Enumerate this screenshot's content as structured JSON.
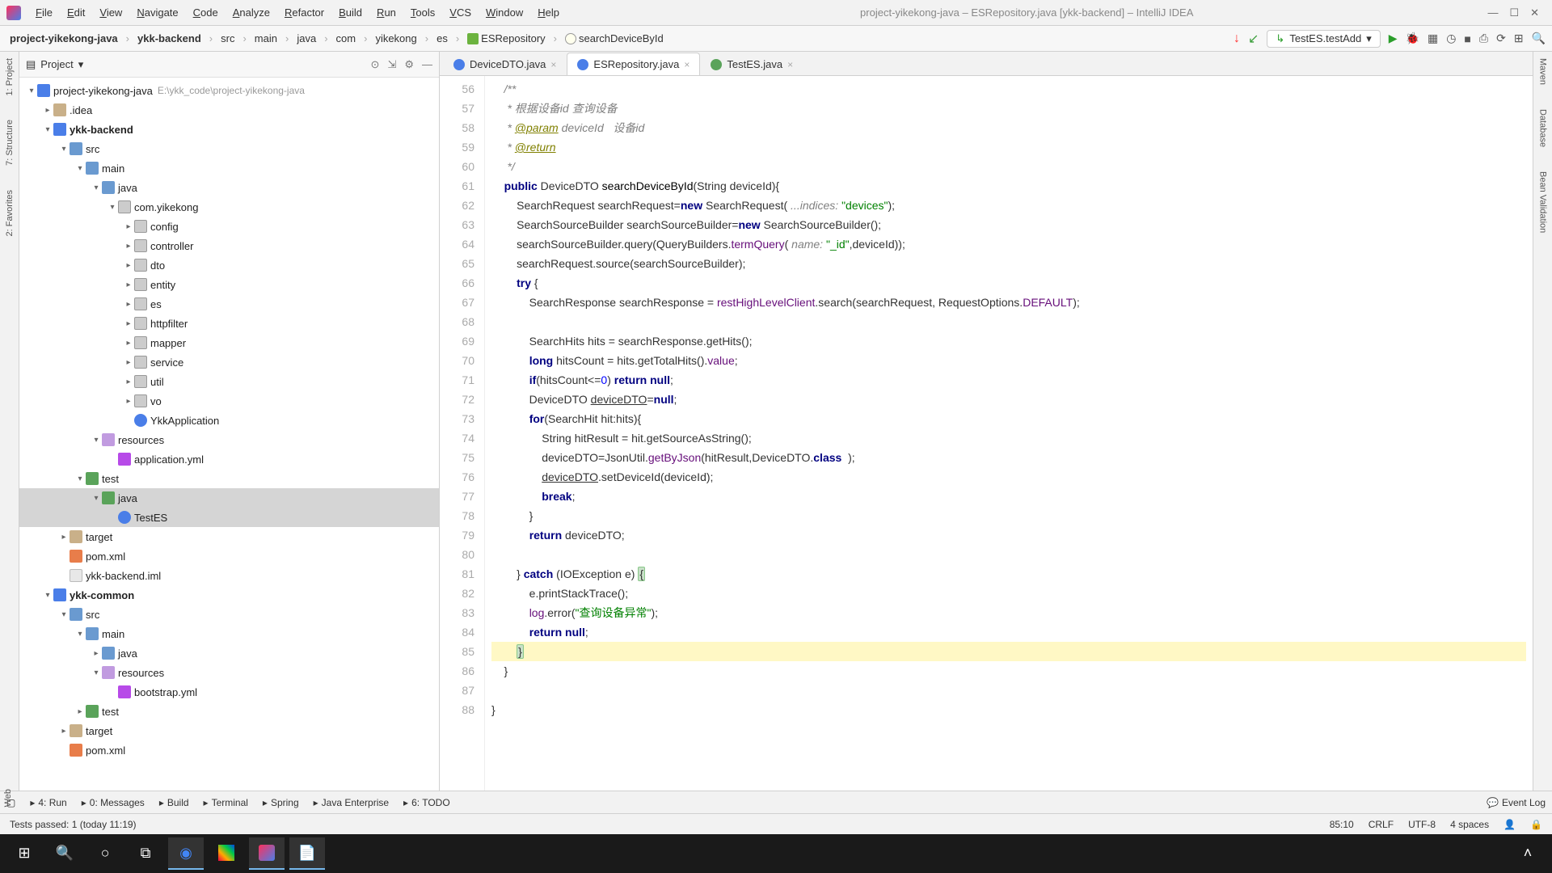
{
  "title": "project-yikekong-java – ESRepository.java [ykk-backend] – IntelliJ IDEA",
  "menus": [
    "File",
    "Edit",
    "View",
    "Navigate",
    "Code",
    "Analyze",
    "Refactor",
    "Build",
    "Run",
    "Tools",
    "VCS",
    "Window",
    "Help"
  ],
  "breadcrumbs": {
    "items": [
      "project-yikekong-java",
      "ykk-backend",
      "src",
      "main",
      "java",
      "com",
      "yikekong",
      "es"
    ],
    "file": "ESRepository",
    "method": "searchDeviceById"
  },
  "run_config": "TestES.testAdd",
  "project_label": "Project",
  "tree": [
    {
      "d": 0,
      "a": "▾",
      "i": "mod",
      "l": "project-yikekong-java",
      "extra": "E:\\ykk_code\\project-yikekong-java"
    },
    {
      "d": 1,
      "a": "▸",
      "i": "dir",
      "l": ".idea"
    },
    {
      "d": 1,
      "a": "▾",
      "i": "mod",
      "l": "ykk-backend",
      "bold": true
    },
    {
      "d": 2,
      "a": "▾",
      "i": "srcdir",
      "l": "src"
    },
    {
      "d": 3,
      "a": "▾",
      "i": "srcdir",
      "l": "main"
    },
    {
      "d": 4,
      "a": "▾",
      "i": "srcdir",
      "l": "java"
    },
    {
      "d": 5,
      "a": "▾",
      "i": "pkg",
      "l": "com.yikekong"
    },
    {
      "d": 6,
      "a": "▸",
      "i": "pkg",
      "l": "config"
    },
    {
      "d": 6,
      "a": "▸",
      "i": "pkg",
      "l": "controller"
    },
    {
      "d": 6,
      "a": "▸",
      "i": "pkg",
      "l": "dto"
    },
    {
      "d": 6,
      "a": "▸",
      "i": "pkg",
      "l": "entity"
    },
    {
      "d": 6,
      "a": "▸",
      "i": "pkg",
      "l": "es"
    },
    {
      "d": 6,
      "a": "▸",
      "i": "pkg",
      "l": "httpfilter"
    },
    {
      "d": 6,
      "a": "▸",
      "i": "pkg",
      "l": "mapper"
    },
    {
      "d": 6,
      "a": "▸",
      "i": "pkg",
      "l": "service"
    },
    {
      "d": 6,
      "a": "▸",
      "i": "pkg",
      "l": "util"
    },
    {
      "d": 6,
      "a": "▸",
      "i": "pkg",
      "l": "vo"
    },
    {
      "d": 6,
      "a": "",
      "i": "java",
      "l": "YkkApplication"
    },
    {
      "d": 4,
      "a": "▾",
      "i": "resdir",
      "l": "resources"
    },
    {
      "d": 5,
      "a": "",
      "i": "yml",
      "l": "application.yml"
    },
    {
      "d": 3,
      "a": "▾",
      "i": "testdir",
      "l": "test"
    },
    {
      "d": 4,
      "a": "▾",
      "i": "testdir",
      "l": "java",
      "sel": true
    },
    {
      "d": 5,
      "a": "",
      "i": "java",
      "l": "TestES",
      "sel": true
    },
    {
      "d": 2,
      "a": "▸",
      "i": "dir",
      "l": "target"
    },
    {
      "d": 2,
      "a": "",
      "i": "xml",
      "l": "pom.xml"
    },
    {
      "d": 2,
      "a": "",
      "i": "file",
      "l": "ykk-backend.iml"
    },
    {
      "d": 1,
      "a": "▾",
      "i": "mod",
      "l": "ykk-common",
      "bold": true
    },
    {
      "d": 2,
      "a": "▾",
      "i": "srcdir",
      "l": "src"
    },
    {
      "d": 3,
      "a": "▾",
      "i": "srcdir",
      "l": "main"
    },
    {
      "d": 4,
      "a": "▸",
      "i": "srcdir",
      "l": "java"
    },
    {
      "d": 4,
      "a": "▾",
      "i": "resdir",
      "l": "resources"
    },
    {
      "d": 5,
      "a": "",
      "i": "yml",
      "l": "bootstrap.yml"
    },
    {
      "d": 3,
      "a": "▸",
      "i": "testdir",
      "l": "test"
    },
    {
      "d": 2,
      "a": "▸",
      "i": "dir",
      "l": "target"
    },
    {
      "d": 2,
      "a": "",
      "i": "xml",
      "l": "pom.xml"
    }
  ],
  "tabs": [
    {
      "label": "DeviceDTO.java",
      "active": false,
      "ic": "blue"
    },
    {
      "label": "ESRepository.java",
      "active": true,
      "ic": "blue"
    },
    {
      "label": "TestES.java",
      "active": false,
      "ic": "green"
    }
  ],
  "code": {
    "start": 56,
    "lines": [
      {
        "t": "doc",
        "txt": "    /**"
      },
      {
        "t": "doc",
        "txt": "     * 根据设备id 查询设备"
      },
      {
        "t": "doc",
        "txt": "     * <tag>@param</tag> deviceId   设备id"
      },
      {
        "t": "doc",
        "txt": "     * <tag>@return</tag>"
      },
      {
        "t": "doc",
        "txt": "     */"
      },
      {
        "t": "code",
        "txt": "    <kw>public</kw> DeviceDTO <call>searchDeviceById</call>(String deviceId){"
      },
      {
        "t": "code",
        "txt": "        SearchRequest searchRequest=<kw>new</kw> SearchRequest( <param>...indices:</param> <str>\"devices\"</str>);"
      },
      {
        "t": "code",
        "txt": "        SearchSourceBuilder searchSourceBuilder=<kw>new</kw> SearchSourceBuilder();"
      },
      {
        "t": "code",
        "txt": "        searchSourceBuilder.query(QueryBuilders.<fld>termQuery</fld>( <param>name:</param> <str>\"_id\"</str>,deviceId));"
      },
      {
        "t": "code",
        "txt": "        searchRequest.source(searchSourceBuilder);"
      },
      {
        "t": "code",
        "txt": "        <kw>try</kw> {"
      },
      {
        "t": "code",
        "txt": "            SearchResponse searchResponse = <fld>restHighLevelClient</fld>.search(searchRequest, RequestOptions.<fld>DEFAULT</fld>);"
      },
      {
        "t": "code",
        "txt": ""
      },
      {
        "t": "code",
        "txt": "            SearchHits hits = searchResponse.getHits();"
      },
      {
        "t": "code",
        "txt": "            <kw>long</kw> hitsCount = hits.getTotalHits().<fld>value</fld>;"
      },
      {
        "t": "code",
        "txt": "            <kw>if</kw>(hitsCount<=<num>0</num>) <kw>return</kw> <kw>null</kw>;"
      },
      {
        "t": "code",
        "txt": "            DeviceDTO <u>deviceDTO</u>=<kw>null</kw>;"
      },
      {
        "t": "code",
        "txt": "            <kw>for</kw>(SearchHit hit:hits){"
      },
      {
        "t": "code",
        "txt": "                String hitResult = hit.getSourceAsString();"
      },
      {
        "t": "code",
        "txt": "                deviceDTO=JsonUtil.<fld>getByJson</fld>(hitResult,DeviceDTO.<kw>class</kw>  );"
      },
      {
        "t": "code",
        "txt": "                <u>deviceDTO</u>.setDeviceId(deviceId);"
      },
      {
        "t": "code",
        "txt": "                <kw>break</kw>;"
      },
      {
        "t": "code",
        "txt": "            }"
      },
      {
        "t": "code",
        "txt": "            <kw>return</kw> deviceDTO;"
      },
      {
        "t": "code",
        "txt": ""
      },
      {
        "t": "code",
        "txt": "        } <kw>catch</kw> (IOException e) <brace>{</brace>"
      },
      {
        "t": "code",
        "txt": "            e.printStackTrace();"
      },
      {
        "t": "code",
        "txt": "            <fld>log</fld>.error(<str>\"查询设备异常\"</str>);"
      },
      {
        "t": "code",
        "txt": "            <kw>return</kw> <kw>null</kw>;"
      },
      {
        "t": "code",
        "txt": "        <brace>}</brace>",
        "hl": true
      },
      {
        "t": "code",
        "txt": "    }"
      },
      {
        "t": "code",
        "txt": ""
      },
      {
        "t": "code",
        "txt": "}"
      }
    ]
  },
  "left_rails": [
    "1: Project",
    "7: Structure",
    "2: Favorites"
  ],
  "right_rails": [
    "Maven",
    "Database",
    "Bean Validation"
  ],
  "bottom_tools": [
    "4: Run",
    "0: Messages",
    "Build",
    "Terminal",
    "Spring",
    "Java Enterprise",
    "6: TODO"
  ],
  "event_log": "Event Log",
  "status": {
    "msg": "Tests passed: 1 (today 11:19)",
    "pos": "85:10",
    "eol": "CRLF",
    "enc": "UTF-8",
    "indent": "4 spaces"
  },
  "web_label": "Web"
}
